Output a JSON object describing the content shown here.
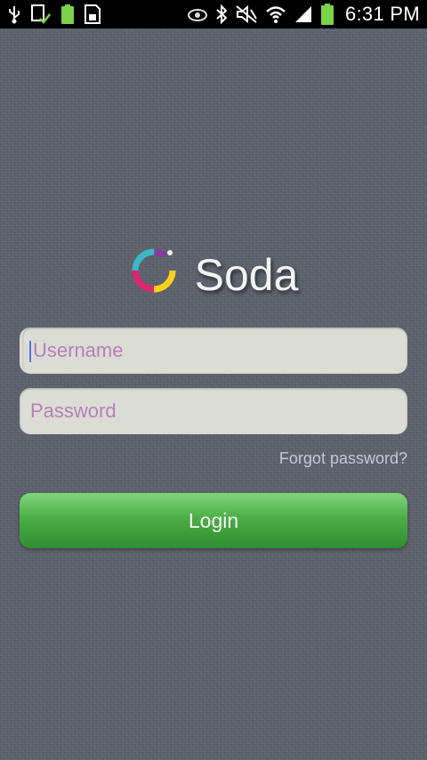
{
  "status_bar": {
    "time": "6:31 PM",
    "left_icons": [
      "usb-icon",
      "device-check-icon",
      "battery-notification-icon",
      "sd-card-icon"
    ],
    "right_icons": [
      "eye-icon",
      "bluetooth-icon",
      "mute-icon",
      "wifi-icon",
      "signal-icon",
      "battery-icon"
    ]
  },
  "app": {
    "title": "Soda",
    "logo_icon": "soda-ring-logo-icon"
  },
  "login_form": {
    "username": {
      "value": "",
      "placeholder": "Username"
    },
    "password": {
      "value": "",
      "placeholder": "Password"
    },
    "forgot_label": "Forgot password?",
    "login_label": "Login"
  },
  "colors": {
    "background": "#5d616c",
    "field_bg": "#dcdcd6",
    "placeholder": "#b77fb8",
    "login_green": "#4cae48",
    "forgot_link": "#bfcbd6"
  }
}
